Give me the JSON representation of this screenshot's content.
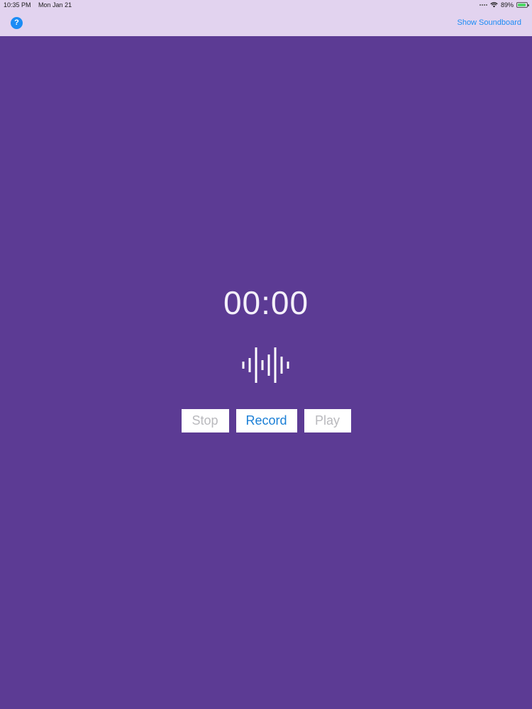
{
  "status_bar": {
    "time": "10:35 PM",
    "date": "Mon Jan 21",
    "battery": "89%",
    "battery_level": 0.89,
    "wifi_icon": "wifi-icon",
    "battery_icon": "battery-icon"
  },
  "nav": {
    "help_label": "?",
    "show_soundboard": "Show Soundboard"
  },
  "timer": {
    "value": "00:00"
  },
  "waveform_icon": "waveform-icon",
  "controls": {
    "stop": "Stop",
    "record": "Record",
    "play": "Play"
  },
  "colors": {
    "background": "#5c3b94",
    "top_bar": "#e2d3ef",
    "accent": "#1b8cf5",
    "disabled_text": "#b9b9bd"
  }
}
